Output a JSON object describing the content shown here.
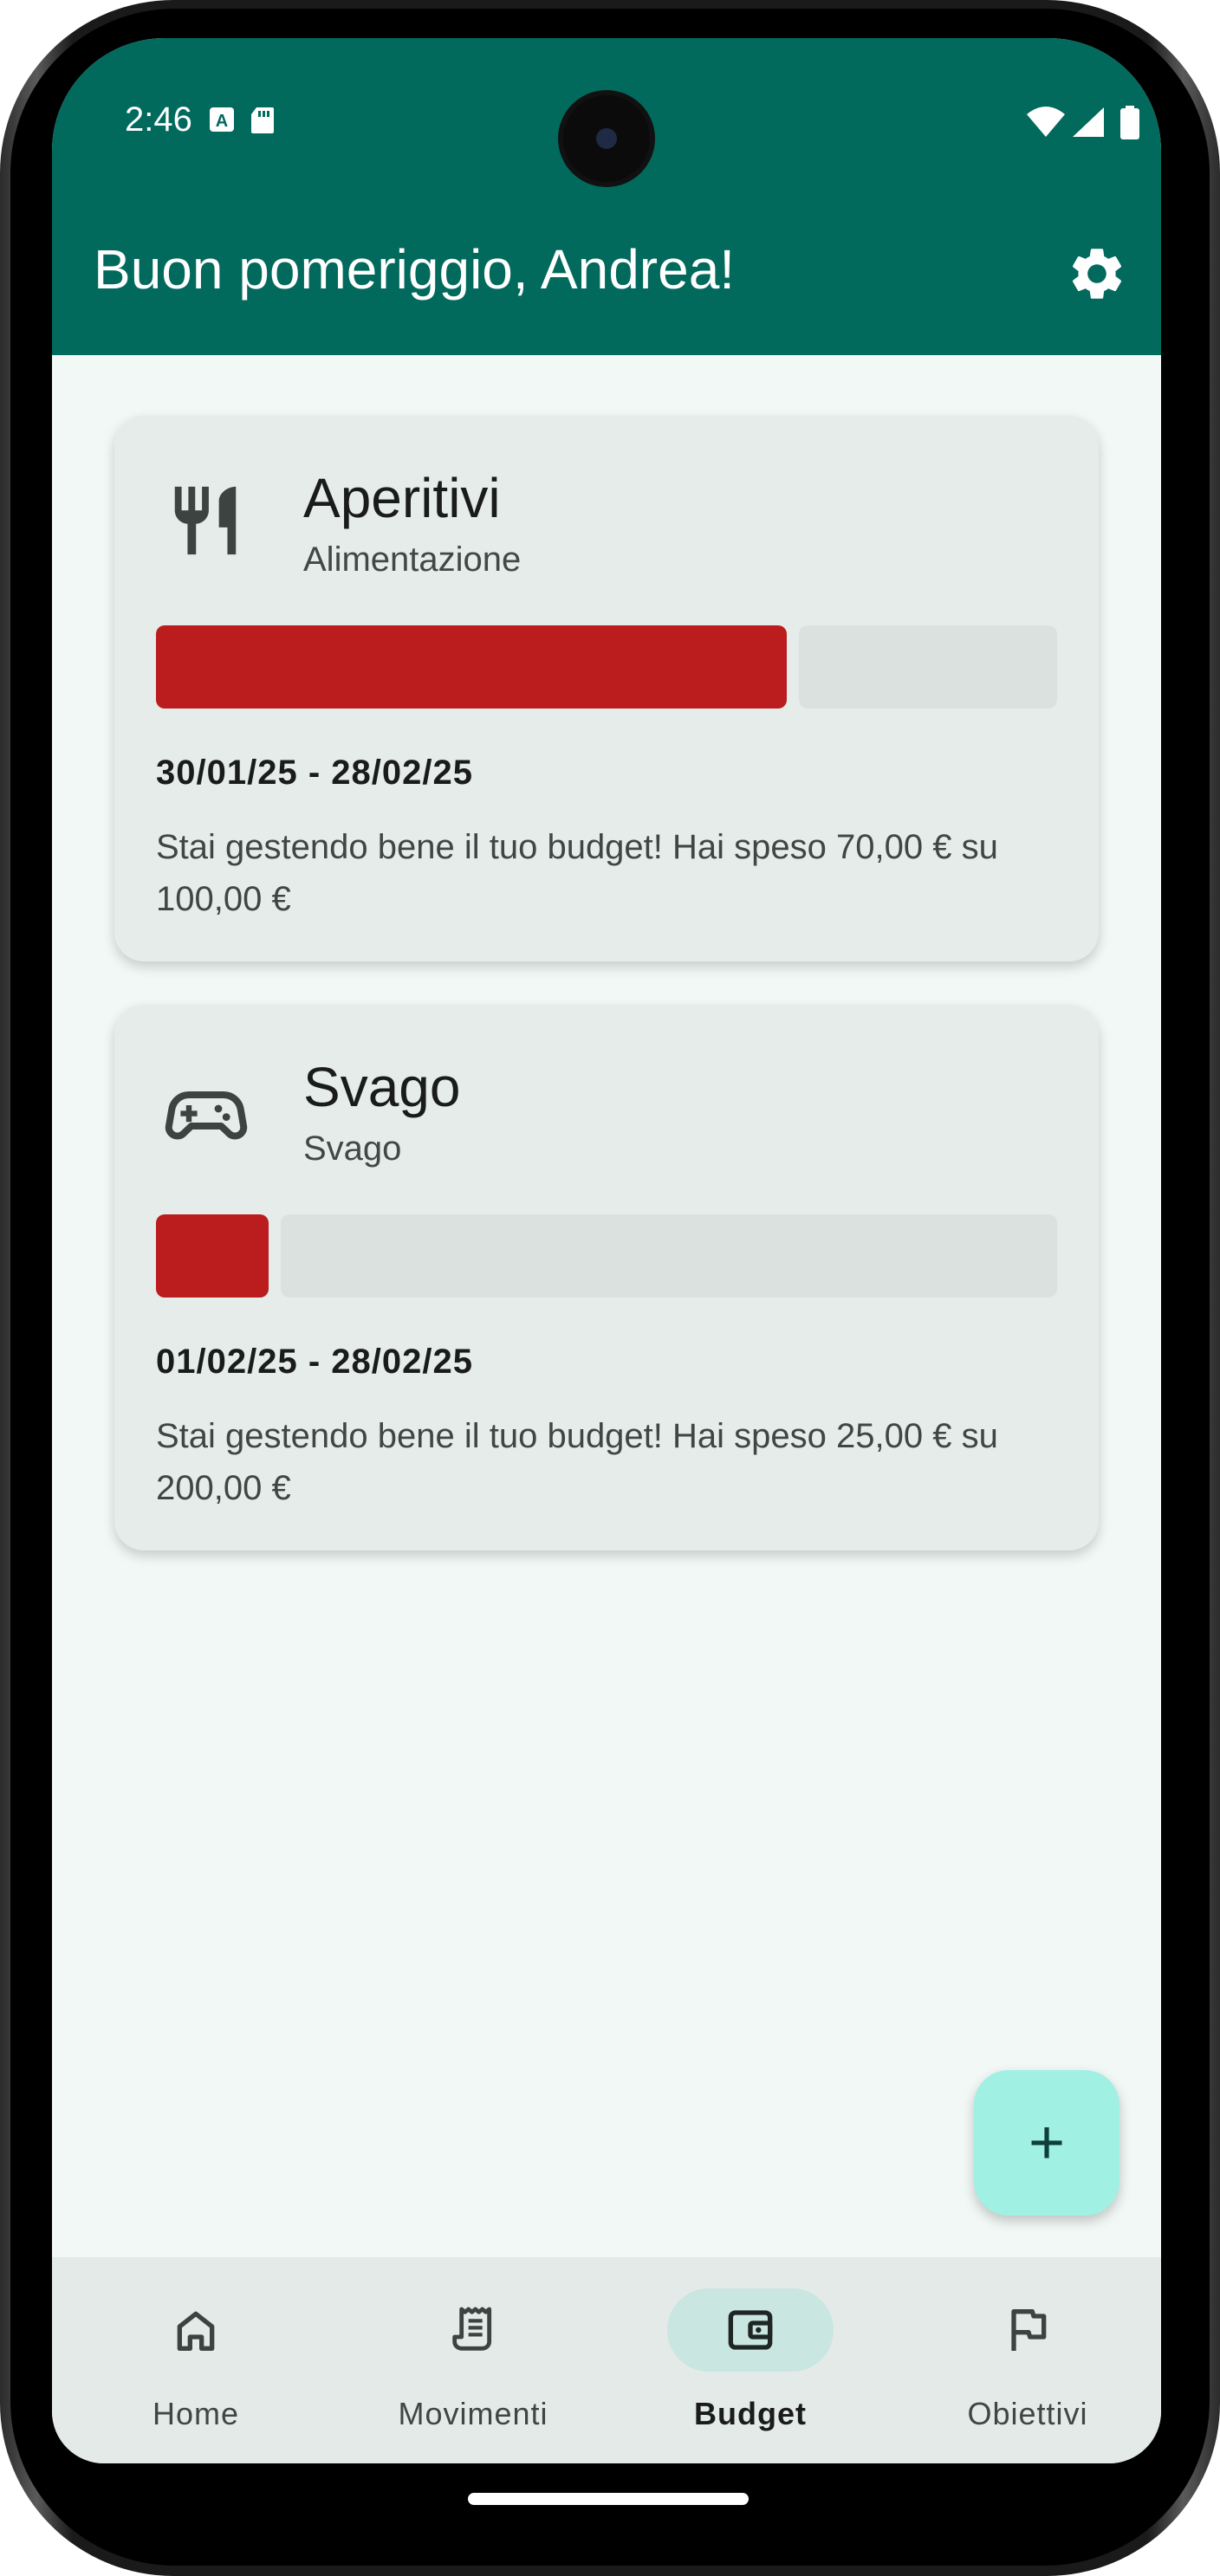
{
  "status_bar": {
    "time": "2:46"
  },
  "header": {
    "greeting": "Buon pomeriggio, Andrea!"
  },
  "budgets": [
    {
      "name": "Aperitivi",
      "category": "Alimentazione",
      "icon": "restaurant-icon",
      "progress": 0.7,
      "dates": "30/01/25 - 28/02/25",
      "message": "Stai gestendo bene il tuo budget! Hai speso 70,00 € su 100,00 €"
    },
    {
      "name": "Svago",
      "category": "Svago",
      "icon": "gamepad-icon",
      "progress": 0.125,
      "dates": "01/02/25 - 28/02/25",
      "message": "Stai gestendo bene il tuo budget! Hai speso 25,00 € su 200,00 €"
    }
  ],
  "fab": {
    "label": "+"
  },
  "nav": [
    {
      "label": "Home",
      "icon": "home-icon",
      "active": false
    },
    {
      "label": "Movimenti",
      "icon": "receipt-icon",
      "active": false
    },
    {
      "label": "Budget",
      "icon": "wallet-icon",
      "active": true
    },
    {
      "label": "Obiettivi",
      "icon": "flag-icon",
      "active": false
    }
  ],
  "colors": {
    "primary": "#02695d",
    "over_budget": "#bb1c1e",
    "fab": "#a0f1e3",
    "active_pill": "#c9e6e0"
  }
}
